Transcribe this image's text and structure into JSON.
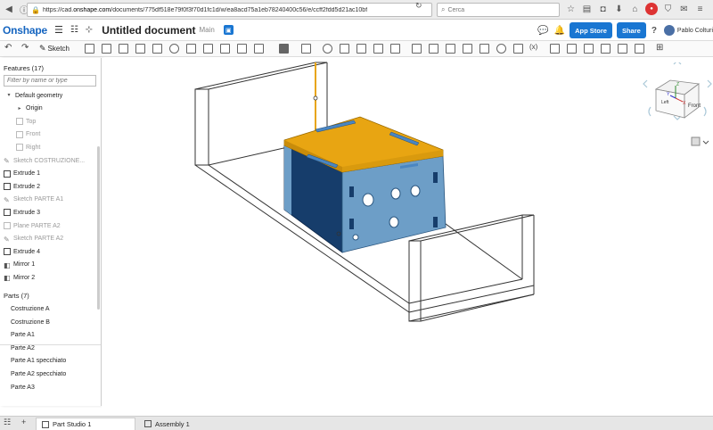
{
  "browser": {
    "url_prefix": "https://cad.",
    "url_domain": "onshape.com",
    "url_path": "/documents/775df518e79f0f3f70d1fc1d/w/ea8acd75a1eb78240400c56/e/ccff2fdd5d21ac10bf",
    "search_placeholder": "Cerca"
  },
  "header": {
    "logo": "Onshape",
    "doc_title": "Untitled document",
    "branch": "Main",
    "app_store": "App Store",
    "share": "Share",
    "help": "?",
    "user": "Pablo Colturi"
  },
  "toolbar": {
    "sketch_label": "Sketch",
    "variable_label": "(x)"
  },
  "features": {
    "title": "Features (17)",
    "filter_placeholder": "Filter by name or type",
    "items": [
      {
        "label": "Default geometry",
        "kind": "group",
        "dim": false
      },
      {
        "label": "Origin",
        "kind": "origin",
        "dim": false
      },
      {
        "label": "Top",
        "kind": "plane",
        "dim": true
      },
      {
        "label": "Front",
        "kind": "plane",
        "dim": true
      },
      {
        "label": "Right",
        "kind": "plane",
        "dim": true
      },
      {
        "label": "Sketch COSTRUZIONE...",
        "kind": "sketch",
        "dim": true
      },
      {
        "label": "Extrude 1",
        "kind": "extrude",
        "dim": false
      },
      {
        "label": "Extrude 2",
        "kind": "extrude",
        "dim": false
      },
      {
        "label": "Sketch PARTE A1",
        "kind": "sketch",
        "dim": true
      },
      {
        "label": "Extrude 3",
        "kind": "extrude",
        "dim": false
      },
      {
        "label": "Plane PARTE A2",
        "kind": "plane",
        "dim": true
      },
      {
        "label": "Sketch PARTE A2",
        "kind": "sketch",
        "dim": true
      },
      {
        "label": "Extrude 4",
        "kind": "extrude",
        "dim": false
      },
      {
        "label": "Mirror 1",
        "kind": "mirror",
        "dim": false
      },
      {
        "label": "Mirror 2",
        "kind": "mirror",
        "dim": false
      }
    ]
  },
  "parts": {
    "title": "Parts (7)",
    "items": [
      "Costruzione A",
      "Costruzione B",
      "Parte A1",
      "Parte A2",
      "Parte A1 specchiato",
      "Parte A2 specchiato",
      "Parte A3"
    ]
  },
  "viewcube": {
    "front": "Front",
    "left": "Left",
    "top": "Top",
    "x": "X",
    "y": "Y",
    "z": "Z"
  },
  "tabs": [
    {
      "label": "Part Studio 1",
      "active": true
    },
    {
      "label": "Assembly 1",
      "active": false
    }
  ],
  "colors": {
    "accent": "#1976d2",
    "part_top": "#e8a512",
    "part_side": "#6d9ec7",
    "part_dark": "#163d6b"
  }
}
